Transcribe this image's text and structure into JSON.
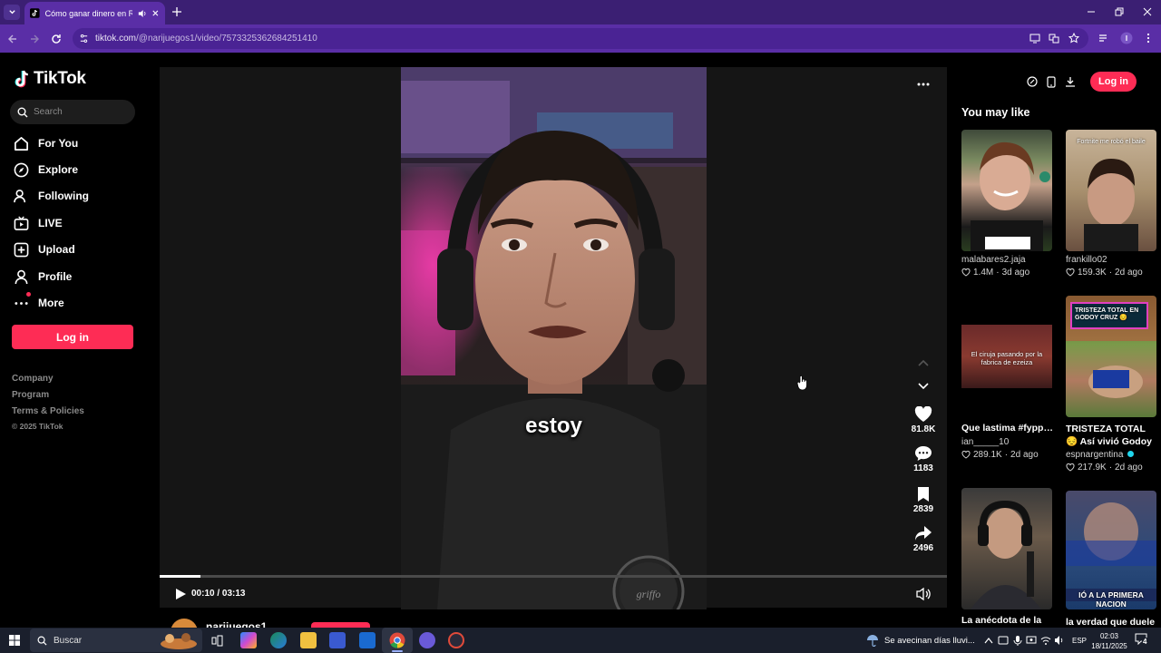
{
  "browser": {
    "tab_title": "Cómo ganar dinero en Rob",
    "url_host": "tiktok.com",
    "url_path": "/@narijuegos1/video/7573325362684251410"
  },
  "sidebar": {
    "brand": "TikTok",
    "search_placeholder": "Search",
    "nav": [
      {
        "label": "For You",
        "icon": "home-icon"
      },
      {
        "label": "Explore",
        "icon": "compass-icon"
      },
      {
        "label": "Following",
        "icon": "following-icon"
      },
      {
        "label": "LIVE",
        "icon": "live-icon"
      },
      {
        "label": "Upload",
        "icon": "upload-icon"
      },
      {
        "label": "Profile",
        "icon": "profile-icon"
      },
      {
        "label": "More",
        "icon": "more-icon"
      }
    ],
    "login": "Log in",
    "footer": [
      "Company",
      "Program",
      "Terms & Policies"
    ],
    "copyright": "© 2025 TikTok"
  },
  "player": {
    "subtitle": "estoy",
    "likes": "81.8K",
    "comments": "1183",
    "saves": "2839",
    "shares": "2496",
    "time": "00:10 / 03:13",
    "progress": 0.052,
    "author": "narijuegos1"
  },
  "top_actions": {
    "login": "Log in"
  },
  "recommendations": {
    "heading": "You may like",
    "items": [
      {
        "title": "",
        "author": "malabares2.jaja",
        "likes": "1.4M",
        "age": "3d ago"
      },
      {
        "title": "",
        "author": "frankillo02",
        "likes": "159.3K",
        "age": "2d ago",
        "overlay": "Fortnite me robó el baile"
      },
      {
        "title": "Que lastima #fyppppppppppppp...",
        "author": "ian_____10",
        "likes": "289.1K",
        "age": "2d ago",
        "overlay": "El ciruja pasando por la fabrica de ezeiza"
      },
      {
        "title": "TRISTEZA TOTAL 😔 Así vivió Godoy Cru...",
        "author": "espnargentina",
        "likes": "217.9K",
        "age": "2d ago",
        "overlay": "TRISTEZA TOTAL EN GODOY CRUZ 😔"
      },
      {
        "title": "La anécdota de la",
        "author": "",
        "likes": "",
        "age": ""
      },
      {
        "title": "la verdad que duele",
        "author": "",
        "likes": "",
        "age": "",
        "overlay": "IÓ A LA PRIMERA NACION"
      }
    ]
  },
  "taskbar": {
    "search_placeholder": "Buscar",
    "weather": "Se avecinan días lluvi...",
    "language": "ESP",
    "time": "02:03",
    "date": "18/11/2025",
    "notifications": "4"
  }
}
